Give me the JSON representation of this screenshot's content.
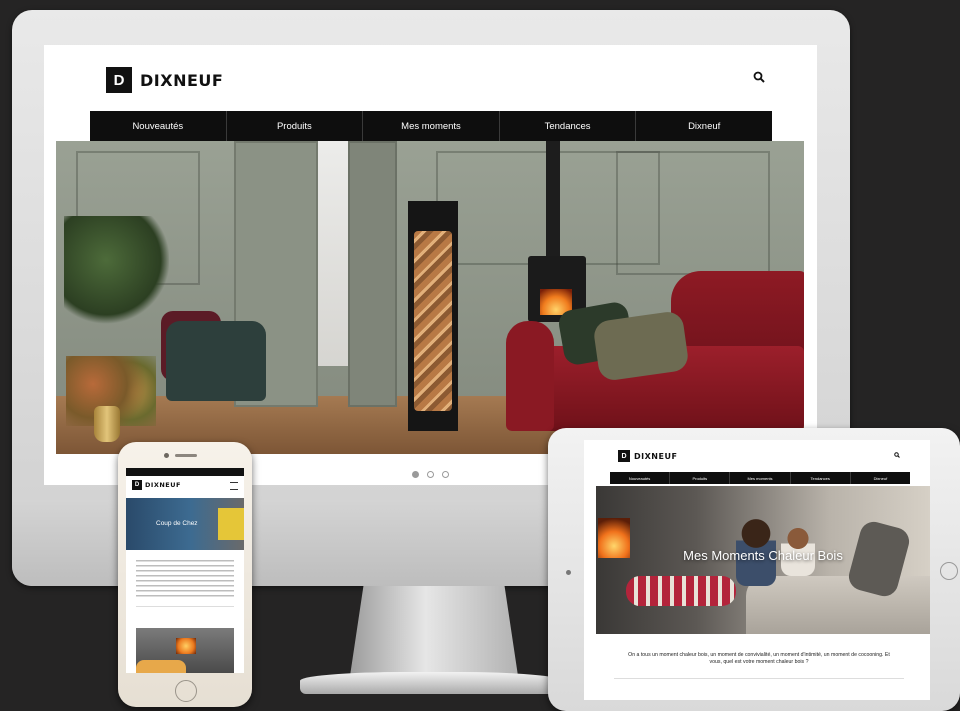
{
  "brand": {
    "logo_letter": "D",
    "name": "DIXNEUF"
  },
  "nav": {
    "items": [
      "Nouveautés",
      "Produits",
      "Mes moments",
      "Tendances",
      "Dixneuf"
    ]
  },
  "carousel": {
    "slides": 3,
    "active_index": 0
  },
  "phone": {
    "hero_label": "Coup de Chez"
  },
  "tablet": {
    "hero_title": "Mes Moments Chaleur Bois",
    "intro": "On a tous un moment chaleur bois, un moment de convivialité, un moment d'intimité, un moment de cocooning. Et vous, quel est votre moment chaleur bois ?"
  },
  "icons": {
    "search": "search-icon",
    "menu": "hamburger-menu-icon"
  },
  "colors": {
    "nav_bg": "#0e0e0e",
    "background": "#252424",
    "accent_red": "#8e1a24"
  }
}
